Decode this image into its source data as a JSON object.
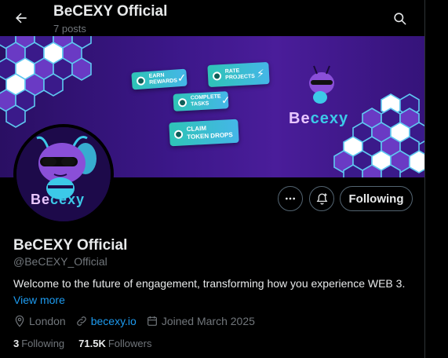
{
  "header": {
    "title": "BeCEXY Official",
    "post_count": "7 posts"
  },
  "banner": {
    "chips": [
      {
        "line1": "EARN",
        "line2": "REWARDS"
      },
      {
        "line1": "RATE",
        "line2": "PROJECTS"
      },
      {
        "line1": "COMPLETE",
        "line2": "TASKS"
      },
      {
        "line1": "CLAIM",
        "line2": "TOKEN DROPS"
      }
    ],
    "brand_be": "Be",
    "brand_rest": "cexy",
    "colors": {
      "accent": "#3cc9e8",
      "purple": "#4a1d9a"
    }
  },
  "avatar": {
    "brand_be": "Be",
    "brand_rest": "cexy"
  },
  "actions": {
    "follow_label": "Following"
  },
  "profile": {
    "name": "BeCEXY Official",
    "handle": "@BeCEXY_Official",
    "bio": "Welcome to the future of engagement, transforming how you experience WEB 3.",
    "view_more": "View more",
    "location": "London",
    "website": "becexy.io",
    "joined": "Joined March 2025",
    "following_count": "3",
    "following_label": "Following",
    "followers_count": "71.5K",
    "followers_label": "Followers"
  },
  "icons": [
    "back-arrow-icon",
    "search-icon",
    "more-icon",
    "notify-bell-icon",
    "location-icon",
    "link-icon",
    "calendar-icon"
  ]
}
